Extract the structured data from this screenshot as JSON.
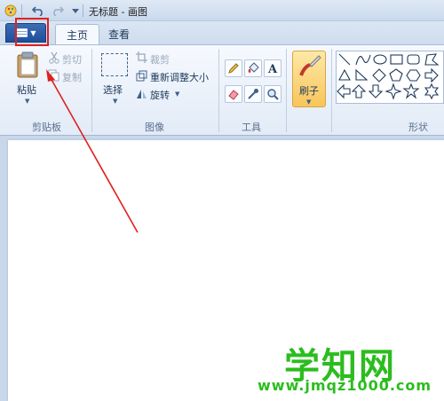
{
  "window": {
    "title": "无标题 - 画图"
  },
  "tabs": [
    {
      "label": "主页",
      "active": true
    },
    {
      "label": "查看",
      "active": false
    }
  ],
  "groups": {
    "clipboard": {
      "label": "剪贴板",
      "paste": "粘贴",
      "cut": "剪切",
      "copy": "复制"
    },
    "image": {
      "label": "图像",
      "select": "选择",
      "crop": "裁剪",
      "resize": "重新调整大小",
      "rotate": "旋转"
    },
    "tools": {
      "label": "工具"
    },
    "brushes": {
      "label": "刷子"
    },
    "shapes": {
      "label": "形状"
    }
  },
  "watermark": {
    "title": "学知网",
    "url": "www.jmqz1000.com"
  },
  "colors": {
    "accent": "#1f4f9a",
    "annotation": "#e0211e",
    "watermark": "#2bbd1e"
  }
}
